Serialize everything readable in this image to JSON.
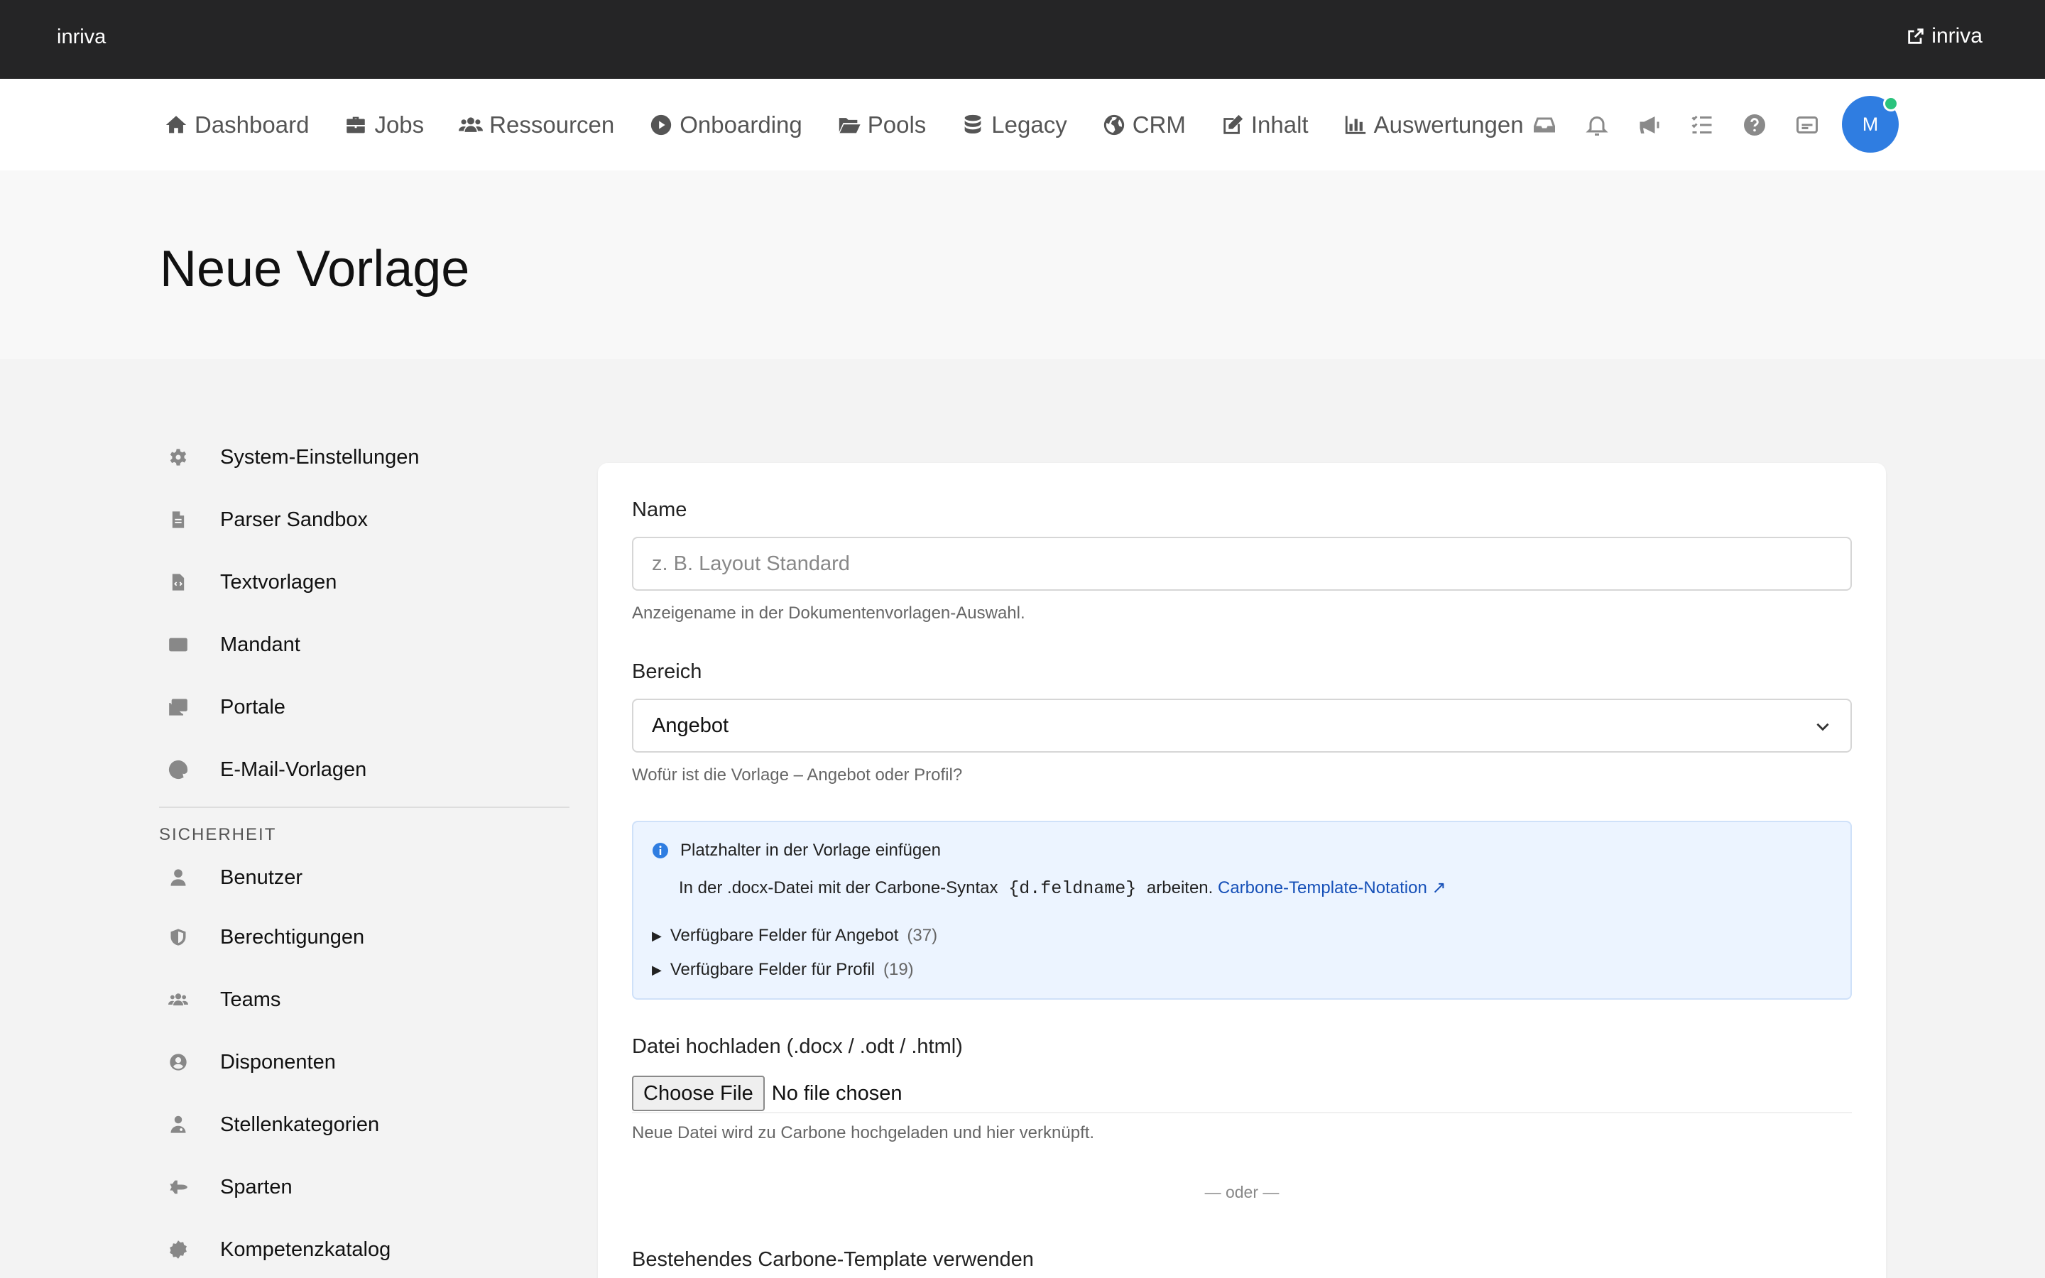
{
  "topbar": {
    "brand": "inriva",
    "external_link": "inriva"
  },
  "nav": {
    "items": [
      {
        "label": "Dashboard",
        "icon": "home-icon"
      },
      {
        "label": "Jobs",
        "icon": "briefcase-icon"
      },
      {
        "label": "Ressourcen",
        "icon": "users-icon"
      },
      {
        "label": "Onboarding",
        "icon": "play-circle-icon"
      },
      {
        "label": "Pools",
        "icon": "folder-open-icon"
      },
      {
        "label": "Legacy",
        "icon": "database-icon"
      },
      {
        "label": "CRM",
        "icon": "globe-icon"
      },
      {
        "label": "Inhalt",
        "icon": "edit-icon"
      },
      {
        "label": "Auswertungen",
        "icon": "bar-chart-icon"
      }
    ],
    "avatar_initial": "M"
  },
  "page": {
    "title": "Neue Vorlage"
  },
  "sidebar": {
    "items": [
      {
        "label": "System-Einstellungen",
        "icon": "gear-icon"
      },
      {
        "label": "Parser Sandbox",
        "icon": "file-icon"
      },
      {
        "label": "Textvorlagen",
        "icon": "file-code-icon"
      },
      {
        "label": "Mandant",
        "icon": "id-card-icon"
      },
      {
        "label": "Portale",
        "icon": "images-icon"
      },
      {
        "label": "E-Mail-Vorlagen",
        "icon": "at-icon"
      }
    ],
    "security_heading": "SICHERHEIT",
    "security_items": [
      {
        "label": "Benutzer",
        "icon": "user-icon"
      },
      {
        "label": "Berechtigungen",
        "icon": "shield-icon"
      },
      {
        "label": "Teams",
        "icon": "users-icon"
      },
      {
        "label": "Disponenten",
        "icon": "user-circle-icon"
      },
      {
        "label": "Stellenkategorien",
        "icon": "user-doctor-icon"
      },
      {
        "label": "Sparten",
        "icon": "shuttle-icon"
      },
      {
        "label": "Kompetenzkatalog",
        "icon": "cog-badge-icon"
      }
    ]
  },
  "form": {
    "name_label": "Name",
    "name_placeholder": "z. B. Layout Standard",
    "name_help": "Anzeigename in der Dokumentenvorlagen-Auswahl.",
    "bereich_label": "Bereich",
    "bereich_value": "Angebot",
    "bereich_help": "Wofür ist die Vorlage – Angebot oder Profil?",
    "info": {
      "title": "Platzhalter in der Vorlage einfügen",
      "text_before": "In der .docx-Datei mit der Carbone-Syntax",
      "code": "{d.feldname}",
      "text_after": "arbeiten.",
      "link": "Carbone-Template-Notation ↗",
      "details_angebot": "Verfügbare Felder für Angebot",
      "details_angebot_count": "(37)",
      "details_profil": "Verfügbare Felder für Profil",
      "details_profil_count": "(19)"
    },
    "upload_label": "Datei hochladen (.docx / .odt / .html)",
    "choose_file": "Choose File",
    "no_file": "No file chosen",
    "upload_help": "Neue Datei wird zu Carbone hochgeladen und hier verknüpft.",
    "divider": "— oder —",
    "existing_label": "Bestehendes Carbone-Template verwenden"
  },
  "colors": {
    "accent": "#2f7de1",
    "topbar": "#252526",
    "online": "#2bc37d",
    "link": "#1650b8"
  }
}
